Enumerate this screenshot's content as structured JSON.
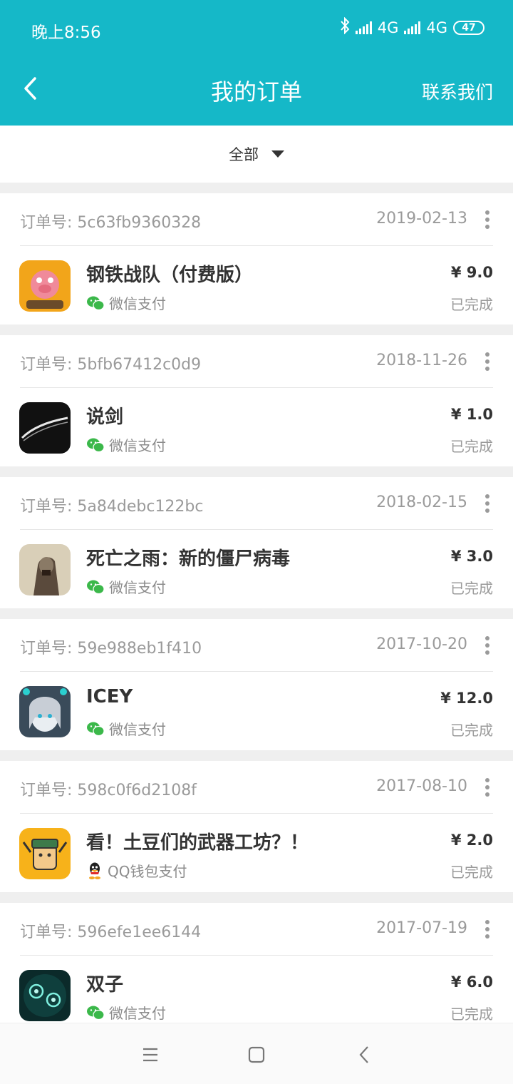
{
  "status_bar": {
    "time": "晚上8:56",
    "network_1": "4G",
    "network_2": "4G",
    "battery": "47"
  },
  "header": {
    "title": "我的订单",
    "contact_label": "联系我们",
    "background": "#15b8c8"
  },
  "filter": {
    "label": "全部"
  },
  "order_id_prefix": "订单号: ",
  "orders": [
    {
      "order_id": "订单号: 5c63fb9360328",
      "date": "2019-02-13",
      "name": "钢铁战队（付费版）",
      "payment": "微信支付",
      "payment_icon": "wechat-pay-icon",
      "price": "¥ 9.0",
      "status": "已完成"
    },
    {
      "order_id": "订单号: 5bfb67412c0d9",
      "date": "2018-11-26",
      "name": "说剑",
      "payment": "微信支付",
      "payment_icon": "wechat-pay-icon",
      "price": "¥ 1.0",
      "status": "已完成"
    },
    {
      "order_id": "订单号: 5a84debc122bc",
      "date": "2018-02-15",
      "name": "死亡之雨：新的僵尸病毒",
      "payment": "微信支付",
      "payment_icon": "wechat-pay-icon",
      "price": "¥ 3.0",
      "status": "已完成"
    },
    {
      "order_id": "订单号: 59e988eb1f410",
      "date": "2017-10-20",
      "name": "ICEY",
      "payment": "微信支付",
      "payment_icon": "wechat-pay-icon",
      "price": "¥ 12.0",
      "status": "已完成"
    },
    {
      "order_id": "订单号: 598c0f6d2108f",
      "date": "2017-08-10",
      "name": "看！土豆们的武器工坊？！",
      "payment": "QQ钱包支付",
      "payment_icon": "qq-wallet-icon",
      "price": "¥ 2.0",
      "status": "已完成"
    },
    {
      "order_id": "订单号: 596efe1ee6144",
      "date": "2017-07-19",
      "name": "双子",
      "payment": "微信支付",
      "payment_icon": "wechat-pay-icon",
      "price": "¥ 6.0",
      "status": "已完成"
    }
  ],
  "colors": {
    "accent": "#15b8c8",
    "wechat": "#3bb84a",
    "divider": "#efefef"
  }
}
